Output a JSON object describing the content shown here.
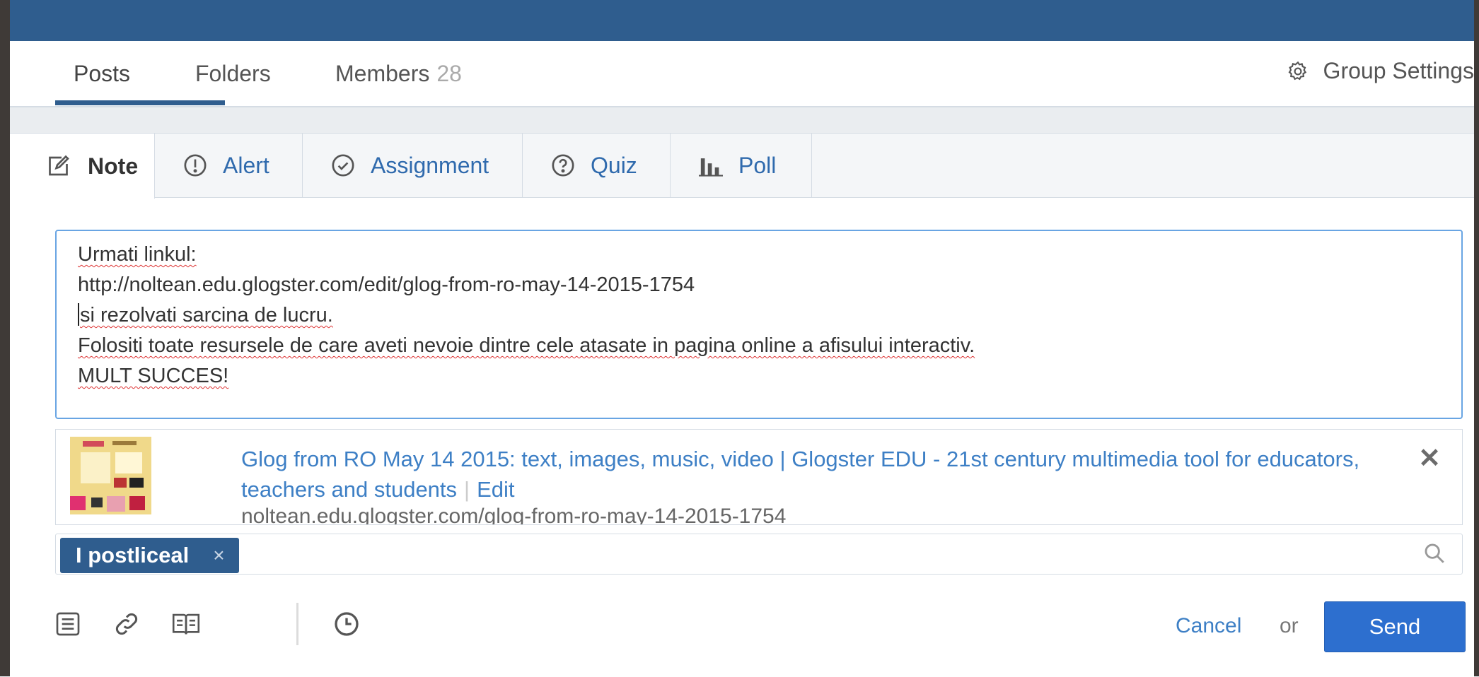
{
  "nav": {
    "tabs": [
      {
        "label": "Posts"
      },
      {
        "label": "Folders"
      },
      {
        "label": "Members",
        "count": "28"
      }
    ],
    "settings_label": "Group Settings"
  },
  "post_types": [
    {
      "label": "Note",
      "icon": "note-edit-icon",
      "active": true
    },
    {
      "label": "Alert",
      "icon": "alert-icon"
    },
    {
      "label": "Assignment",
      "icon": "assignment-check-icon"
    },
    {
      "label": "Quiz",
      "icon": "quiz-question-icon"
    },
    {
      "label": "Poll",
      "icon": "poll-bar-icon"
    }
  ],
  "editor": {
    "lines": [
      "Urmati linkul:",
      "http://noltean.edu.glogster.com/edit/glog-from-ro-may-14-2015-1754",
      "si rezolvati sarcina de lucru.",
      "Folositi toate resursele de care aveti nevoie dintre cele atasate in pagina online a afisului interactiv.",
      "MULT SUCCES!"
    ]
  },
  "link_preview": {
    "title": "Glog from RO May 14 2015: text, images, music, video | Glogster EDU - 21st century multimedia tool for educators, teachers and students",
    "edit_label": "Edit",
    "url": "noltean.edu.glogster.com/glog-from-ro-may-14-2015-1754",
    "close_icon": "close-icon"
  },
  "recipients": {
    "chips": [
      {
        "label": "I postliceal"
      }
    ],
    "remove_glyph": "×",
    "search_icon": "search-icon"
  },
  "toolbar": {
    "icons": [
      "file-icon",
      "link-icon",
      "library-icon",
      "schedule-clock-icon"
    ],
    "cancel_label": "Cancel",
    "or_label": "or",
    "send_label": "Send"
  },
  "colors": {
    "brand": "#2f5d8e",
    "link": "#3d7fc5",
    "send_button": "#2d6fcf"
  }
}
